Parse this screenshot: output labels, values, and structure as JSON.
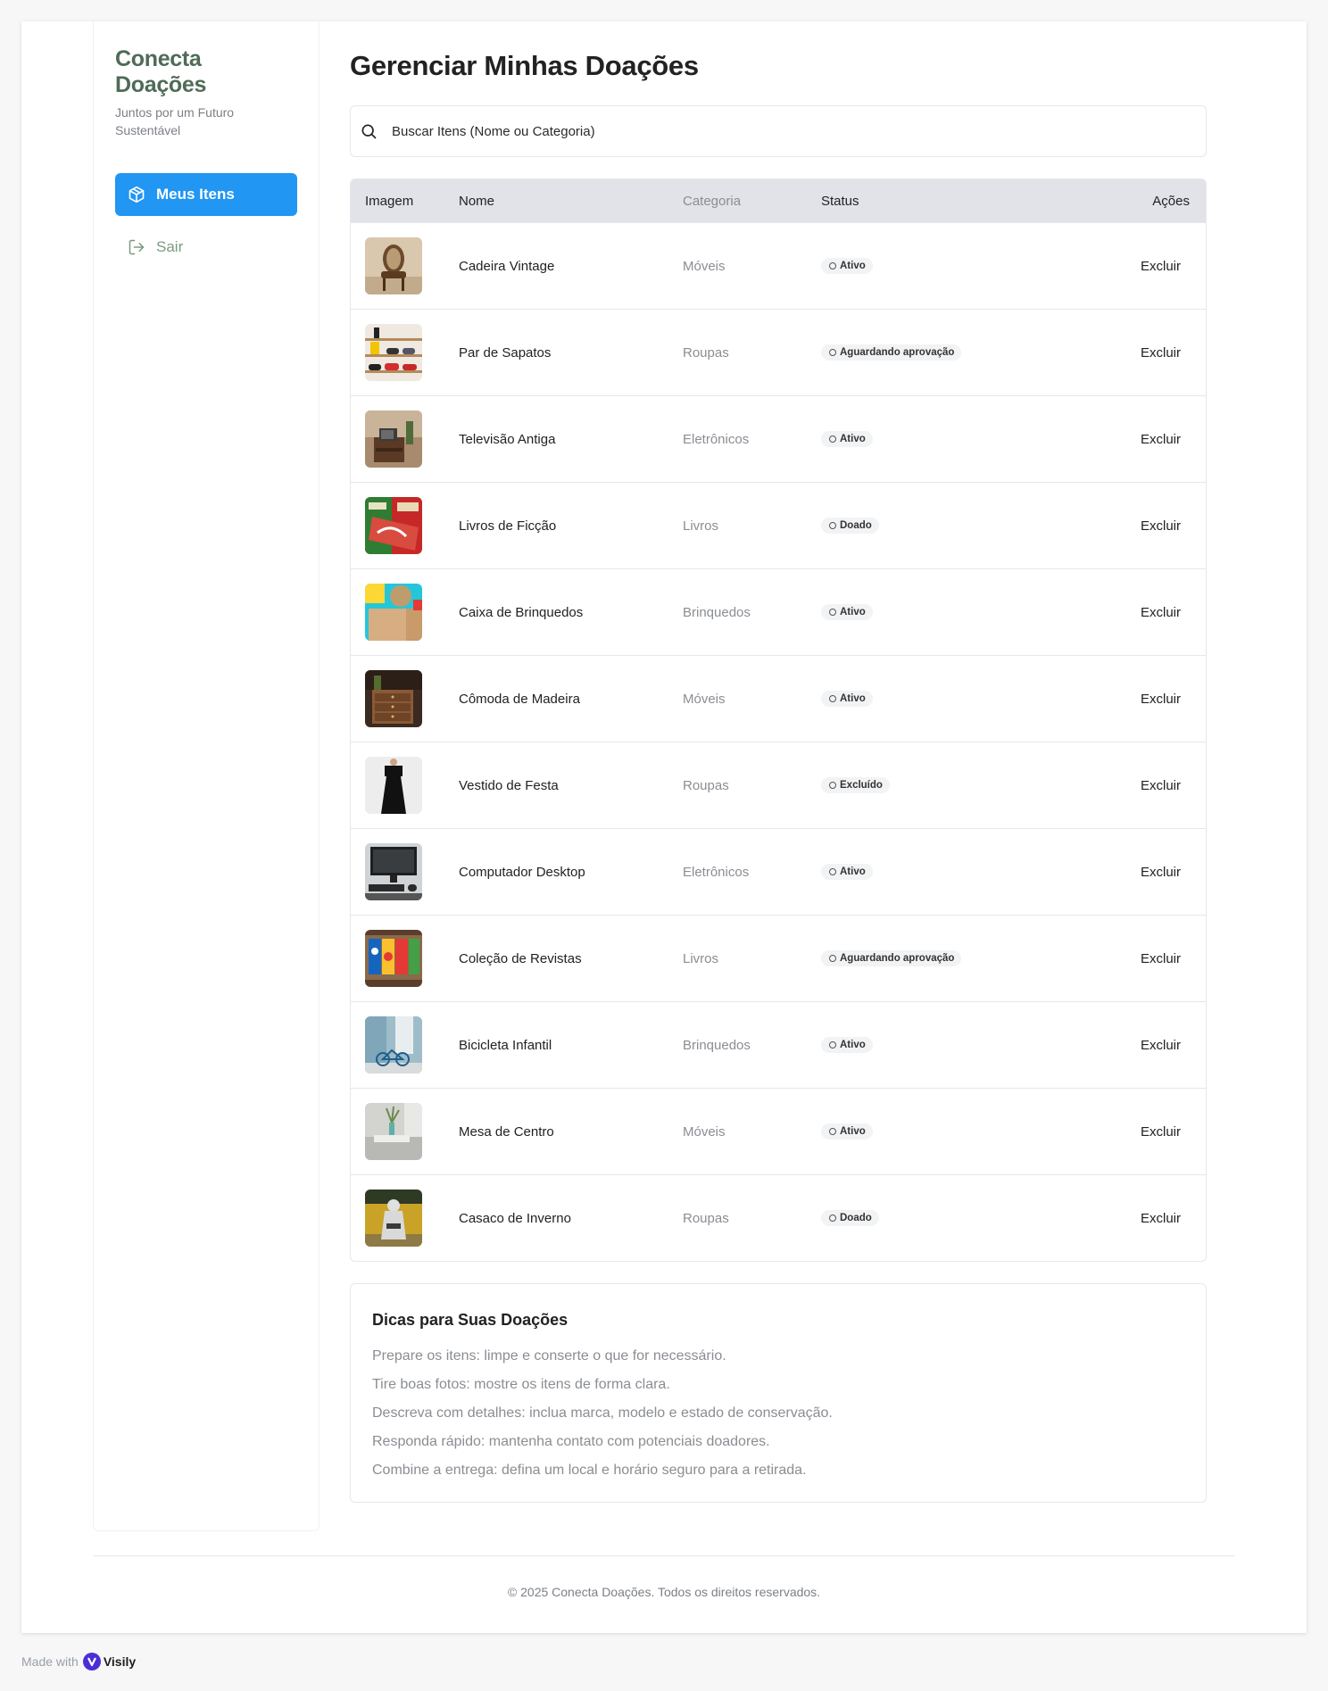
{
  "sidebar": {
    "brand": "Conecta Doações",
    "tagline": "Juntos por um Futuro Sustentável",
    "items": [
      {
        "label": "Meus Itens",
        "icon": "box-icon",
        "active": true
      },
      {
        "label": "Sair",
        "icon": "logout-icon",
        "active": false
      }
    ]
  },
  "main": {
    "title": "Gerenciar Minhas Doações",
    "search": {
      "placeholder": "Buscar Itens (Nome ou Categoria)",
      "value": ""
    },
    "table": {
      "headers": {
        "image": "Imagem",
        "name": "Nome",
        "category": "Categoria",
        "status": "Status",
        "actions": "Ações"
      },
      "rows": [
        {
          "name": "Cadeira Vintage",
          "category": "Móveis",
          "status": "Ativo",
          "action": "Excluir",
          "thumb": "chair"
        },
        {
          "name": "Par de Sapatos",
          "category": "Roupas",
          "status": "Aguardando aprovação",
          "action": "Excluir",
          "thumb": "shoes"
        },
        {
          "name": "Televisão Antiga",
          "category": "Eletrônicos",
          "status": "Ativo",
          "action": "Excluir",
          "thumb": "tv"
        },
        {
          "name": "Livros de Ficção",
          "category": "Livros",
          "status": "Doado",
          "action": "Excluir",
          "thumb": "books"
        },
        {
          "name": "Caixa de Brinquedos",
          "category": "Brinquedos",
          "status": "Ativo",
          "action": "Excluir",
          "thumb": "toys"
        },
        {
          "name": "Cômoda de Madeira",
          "category": "Móveis",
          "status": "Ativo",
          "action": "Excluir",
          "thumb": "dresser"
        },
        {
          "name": "Vestido de Festa",
          "category": "Roupas",
          "status": "Excluído",
          "action": "Excluir",
          "thumb": "dress"
        },
        {
          "name": "Computador Desktop",
          "category": "Eletrônicos",
          "status": "Ativo",
          "action": "Excluir",
          "thumb": "computer"
        },
        {
          "name": "Coleção de Revistas",
          "category": "Livros",
          "status": "Aguardando aprovação",
          "action": "Excluir",
          "thumb": "magazines"
        },
        {
          "name": "Bicicleta Infantil",
          "category": "Brinquedos",
          "status": "Ativo",
          "action": "Excluir",
          "thumb": "bike"
        },
        {
          "name": "Mesa de Centro",
          "category": "Móveis",
          "status": "Ativo",
          "action": "Excluir",
          "thumb": "table"
        },
        {
          "name": "Casaco de Inverno",
          "category": "Roupas",
          "status": "Doado",
          "action": "Excluir",
          "thumb": "coat"
        }
      ]
    },
    "tips": {
      "title": "Dicas para Suas Doações",
      "items": [
        "Prepare os itens: limpe e conserte o que for necessário.",
        "Tire boas fotos: mostre os itens de forma clara.",
        "Descreva com detalhes: inclua marca, modelo e estado de conservação.",
        "Responda rápido: mantenha contato com potenciais doadores.",
        "Combine a entrega: defina um local e horário seguro para a retirada."
      ]
    }
  },
  "footer": {
    "text": "© 2025 Conecta Doações. Todos os direitos reservados."
  },
  "made_with": {
    "prefix": "Made with",
    "brand": "Visily"
  },
  "colors": {
    "accent": "#2196f3",
    "brand": "#4f6b57",
    "header_bg": "#e1e3e8"
  }
}
